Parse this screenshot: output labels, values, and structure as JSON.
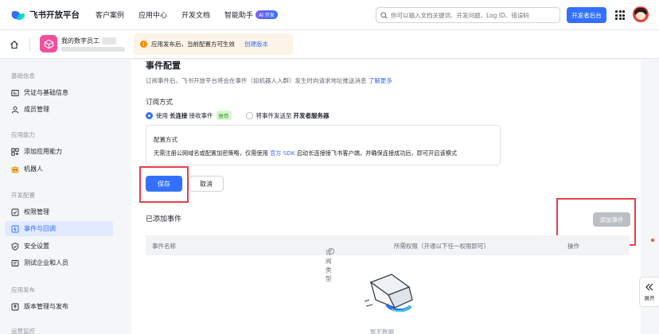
{
  "topnav": {
    "logo_text": "飞书开放平台",
    "items": [
      "客户案例",
      "应用中心",
      "开发文档",
      "智能助手"
    ],
    "ai_badge": "AI 开发",
    "search_placeholder": "你可以输入文档关键词、开发问题、Log ID、错误码",
    "dev_console": "开发者后台"
  },
  "subbar": {
    "app_name": "我的数字员工",
    "notice_text": "应用发布后，当前配置方可生效",
    "notice_link": "创建版本"
  },
  "sidebar": {
    "groups": [
      {
        "label": "基础信息",
        "items": [
          {
            "label": "凭证与基础信息",
            "icon": "id-card-icon"
          },
          {
            "label": "成员管理",
            "icon": "user-icon"
          }
        ]
      },
      {
        "label": "应用能力",
        "items": [
          {
            "label": "添加应用能力",
            "icon": "apps-add-icon"
          },
          {
            "label": "机器人",
            "icon": "robot-icon"
          }
        ]
      },
      {
        "label": "开发配置",
        "items": [
          {
            "label": "权限管理",
            "icon": "permission-icon"
          },
          {
            "label": "事件与回调",
            "icon": "event-icon",
            "active": true
          },
          {
            "label": "安全设置",
            "icon": "shield-icon"
          },
          {
            "label": "测试企业和人员",
            "icon": "test-icon"
          }
        ]
      },
      {
        "label": "应用发布",
        "items": [
          {
            "label": "版本管理与发布",
            "icon": "upload-icon"
          }
        ]
      },
      {
        "label": "运营监控",
        "items": []
      }
    ]
  },
  "main": {
    "title": "事件配置",
    "desc": "订阅事件后，飞书开放平台将会在事件（如机器人入群）发生时向请求地址推送消息",
    "desc_link": "了解更多",
    "subscribe_title": "订阅方式",
    "opt1_pre": "使用",
    "opt1_bold": "长连接",
    "opt1_post": "接收事件",
    "opt1_tag": "推荐",
    "opt2_pre": "将事件发送至",
    "opt2_bold": "开发者服务器",
    "config_title": "配置方式",
    "config_desc_pre": "无需注册公网域名或配置加密策略，仅需使用",
    "config_desc_link": "官方 SDK",
    "config_desc_post": "启动长连接接飞书客户端，并确保连接成功后，即可开启该模式",
    "save": "保存",
    "cancel": "取消",
    "added_title": "已添加事件",
    "add_event": "添加事件",
    "columns": [
      "事件名称",
      "订阅类型",
      "所需权限（开通以下任一权限即可）",
      "操作"
    ],
    "empty": "暂无数据"
  },
  "expand_label": "展开"
}
